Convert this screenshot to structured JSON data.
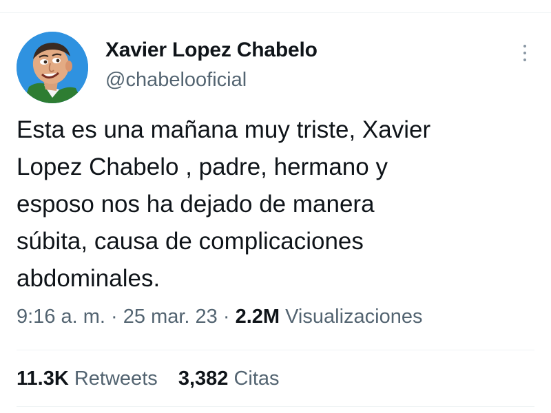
{
  "user": {
    "display_name": "Xavier Lopez Chabelo",
    "handle": "@chabelooficial"
  },
  "tweet": {
    "text": "Esta es una mañana muy triste,  Xavier\nLopez Chabelo , padre, hermano y\nesposo nos ha dejado de manera\nsúbita, causa de complicaciones\nabdominales."
  },
  "meta": {
    "time": "9:16 a. m.",
    "separator": " · ",
    "date": "25 mar. 23",
    "views_count": "2.2M",
    "views_label": "Visualizaciones"
  },
  "stats": {
    "retweets_count": "11.3K",
    "retweets_label": "Retweets",
    "quotes_count": "3,382",
    "quotes_label": "Citas"
  },
  "colors": {
    "text_primary": "#0f1419",
    "text_secondary": "#536471",
    "divider": "#eff3f4",
    "avatar_background": "#2f92e0"
  },
  "icons": {
    "more": "more-options-vertical-dots-icon",
    "avatar": "profile-photo"
  }
}
